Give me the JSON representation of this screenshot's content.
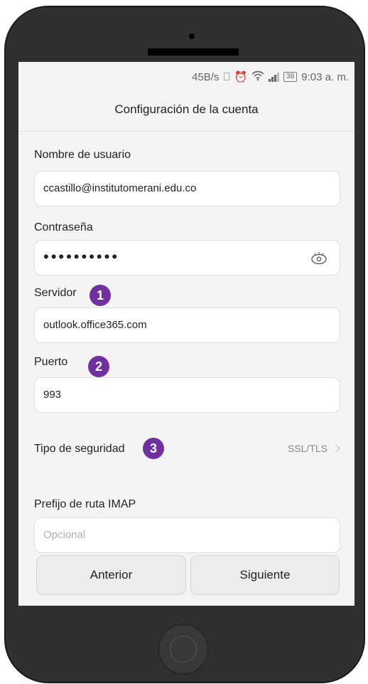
{
  "status_bar": {
    "speed": "45B/s",
    "battery": "38",
    "time": "9:03 a. m."
  },
  "header": {
    "title": "Configuración de la cuenta"
  },
  "form": {
    "username_label": "Nombre de usuario",
    "username_value": "ccastillo@institutomerani.edu.co",
    "password_label": "Contraseña",
    "password_value": "••••••••••",
    "server_label": "Servidor",
    "server_value": "outlook.office365.com",
    "port_label": "Puerto",
    "port_value": "993",
    "security_label": "Tipo de seguridad",
    "security_value": "SSL/TLS",
    "imap_label": "Prefijo de ruta IMAP",
    "imap_placeholder": "Opcional"
  },
  "badges": {
    "one": "1",
    "two": "2",
    "three": "3",
    "color": "#7030a0"
  },
  "buttons": {
    "previous": "Anterior",
    "next": "Siguiente"
  },
  "icons": [
    "vibrate-icon",
    "alarm-icon",
    "wifi-icon",
    "signal-icon",
    "battery-icon",
    "eye-icon",
    "chevron-right-icon",
    "home-button"
  ]
}
